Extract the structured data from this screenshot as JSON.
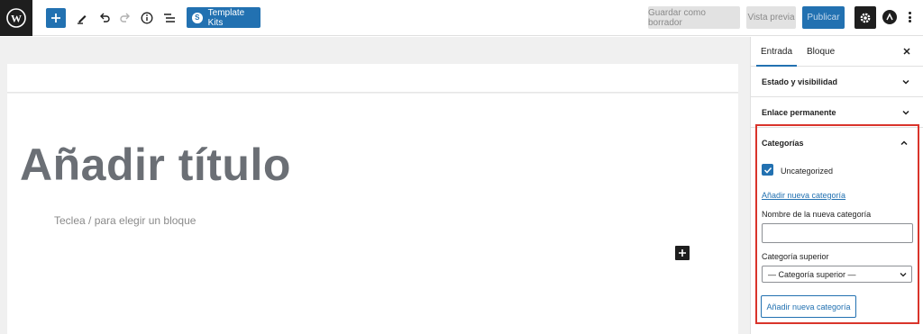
{
  "toolbar": {
    "template_kits_label": "Template Kits",
    "save_draft_label": "Guardar como borrador",
    "preview_label": "Vista previa",
    "publish_label": "Publicar"
  },
  "editor": {
    "title_placeholder": "Añadir título",
    "block_placeholder": "Teclea / para elegir un bloque"
  },
  "sidebar": {
    "tabs": [
      {
        "label": "Entrada",
        "active": true
      },
      {
        "label": "Bloque",
        "active": false
      }
    ],
    "panels": [
      {
        "title": "Estado y visibilidad",
        "expanded": false
      },
      {
        "title": "Enlace permanente",
        "expanded": false
      }
    ],
    "categories": {
      "title": "Categorías",
      "items": [
        {
          "label": "Uncategorized",
          "checked": true
        }
      ],
      "add_link_label": "Añadir nueva categoría",
      "new_name_label": "Nombre de la nueva categoría",
      "new_name_value": "",
      "parent_label": "Categoría superior",
      "parent_selected": "— Categoría superior —",
      "add_button_label": "Añadir nueva categoría"
    }
  },
  "colors": {
    "accent": "#2271b1",
    "highlight": "#d9342b",
    "dark": "#1e1e1e"
  },
  "icons": [
    "wordpress-logo-icon",
    "plus-icon",
    "pencil-icon",
    "undo-icon",
    "redo-icon",
    "info-icon",
    "list-view-icon",
    "gear-icon",
    "astra-icon",
    "more-icon",
    "close-icon",
    "chevron-down-icon",
    "chevron-up-icon",
    "check-icon"
  ]
}
